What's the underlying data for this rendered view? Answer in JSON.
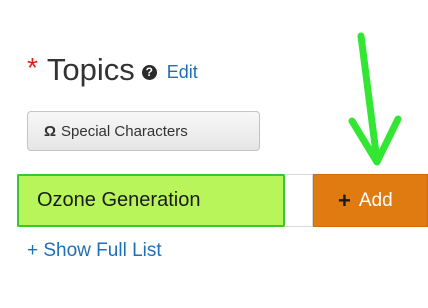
{
  "topics": {
    "required_marker": "*",
    "title": "Topics",
    "help_icon_glyph": "?",
    "edit_label": "Edit"
  },
  "special_characters": {
    "icon_glyph": "Ω",
    "label": "Special Characters"
  },
  "topic_input": {
    "value": "Ozone Generation"
  },
  "add_button": {
    "icon_glyph": "+",
    "label": "Add"
  },
  "show_full_list": {
    "label": "+ Show Full List"
  },
  "colors": {
    "required_star": "#d9241a",
    "link": "#1f6fb5",
    "add_button": "#e07b12",
    "highlight_fill": "#b8f55a",
    "highlight_border": "#3ac43a",
    "arrow": "#33e633"
  },
  "annotation": {
    "arrow_icon": "arrow-down-icon",
    "points_to": "add-button"
  }
}
